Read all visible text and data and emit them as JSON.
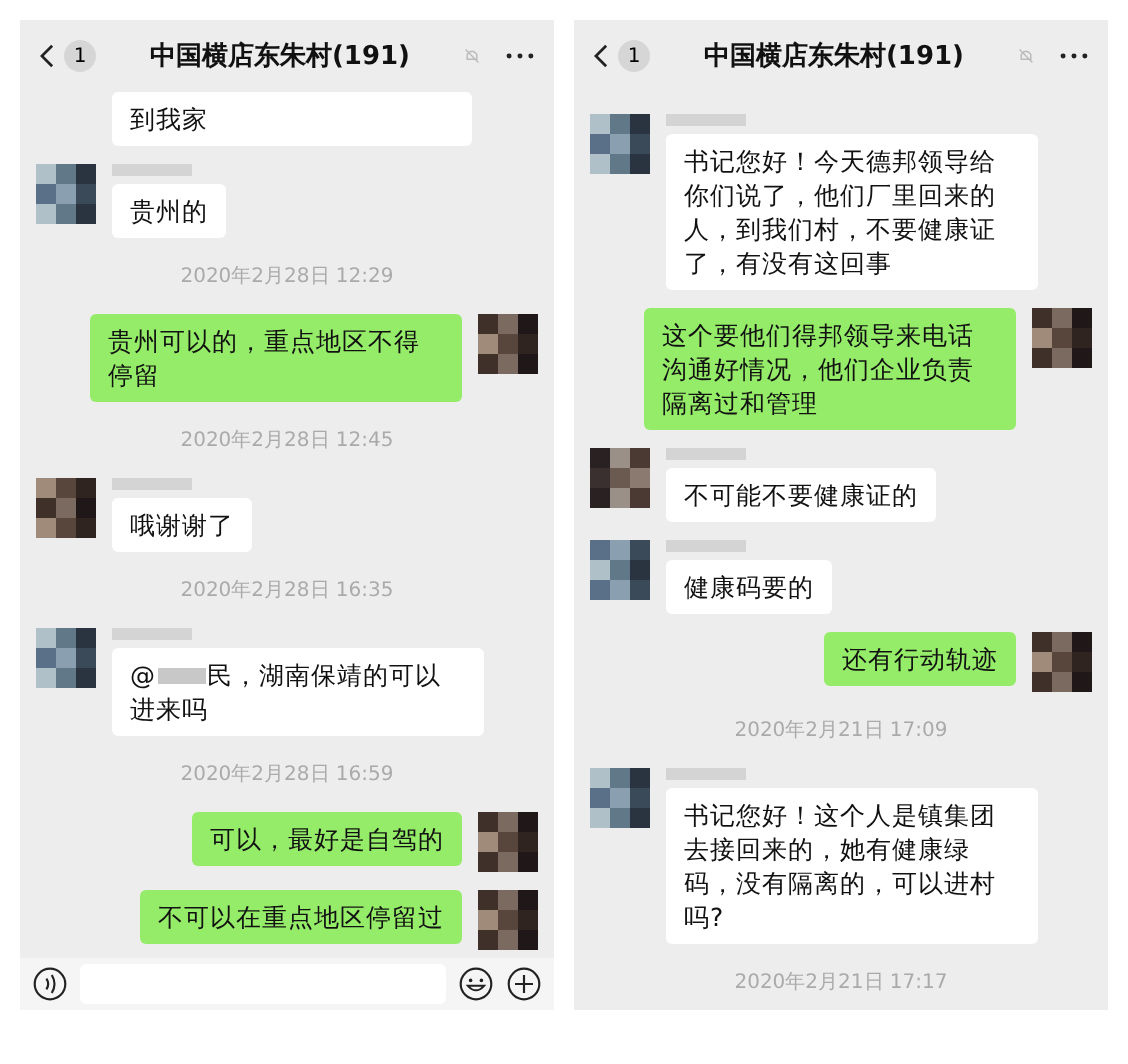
{
  "panels": [
    {
      "header": {
        "unread": "1",
        "title": "中国横店东朱村(191)"
      },
      "has_input_bar": true,
      "messages": [
        {
          "kind": "in_cont",
          "text": "到我家"
        },
        {
          "kind": "in",
          "text": "贵州的"
        },
        {
          "kind": "time",
          "text": "2020年2月28日 12:29"
        },
        {
          "kind": "out",
          "text": "贵州可以的，重点地区不得停留"
        },
        {
          "kind": "time",
          "text": "2020年2月28日 12:45"
        },
        {
          "kind": "in",
          "text": "哦谢谢了"
        },
        {
          "kind": "time",
          "text": "2020年2月28日 16:35"
        },
        {
          "kind": "mention",
          "prefix": "@",
          "text": "民，湖南保靖的可以进来吗"
        },
        {
          "kind": "time",
          "text": "2020年2月28日 16:59"
        },
        {
          "kind": "out",
          "text": "可以，最好是自驾的"
        },
        {
          "kind": "out",
          "text": "不可以在重点地区停留过"
        }
      ]
    },
    {
      "header": {
        "unread": "1",
        "title": "中国横店东朱村(191)"
      },
      "has_input_bar": false,
      "messages": [
        {
          "kind": "in",
          "text": "书记您好！今天德邦领导给你们说了，他们厂里回来的人，到我们村，不要健康证了，有没有这回事"
        },
        {
          "kind": "out",
          "text": "这个要他们得邦领导来电话沟通好情况，他们企业负责隔离过和管理"
        },
        {
          "kind": "in",
          "text": "不可能不要健康证的"
        },
        {
          "kind": "in",
          "text": "健康码要的"
        },
        {
          "kind": "out",
          "text": "还有行动轨迹"
        },
        {
          "kind": "time",
          "text": "2020年2月21日 17:09"
        },
        {
          "kind": "in",
          "text": "书记您好！这个人是镇集团去接回来的，她有健康绿码，没有隔离的，可以进村吗?"
        },
        {
          "kind": "time",
          "text": "2020年2月21日 17:17"
        }
      ]
    }
  ]
}
